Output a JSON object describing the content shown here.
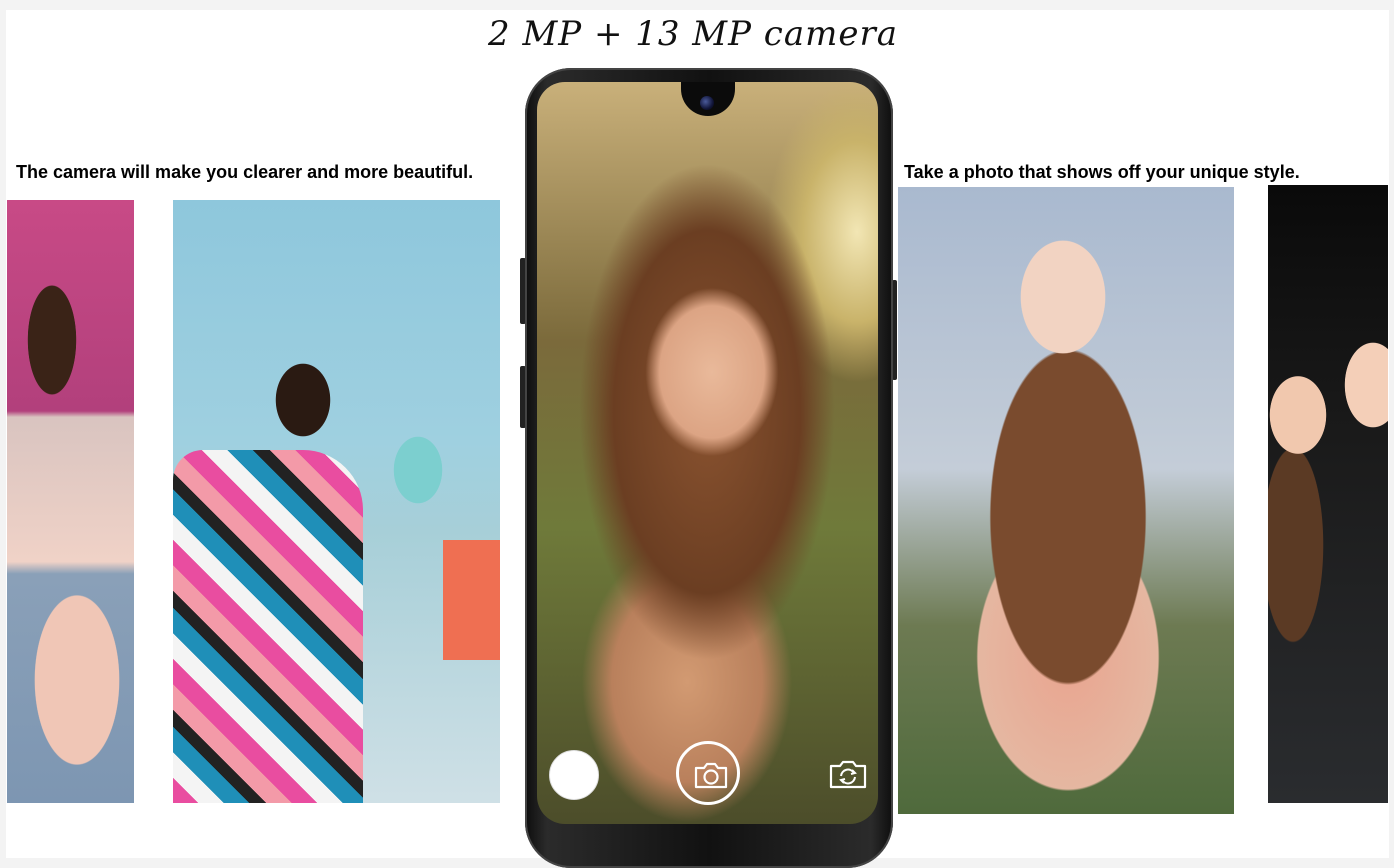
{
  "headline": "2 MP + 13 MP camera",
  "captions": {
    "left": "The camera will make you clearer and more beautiful.",
    "right": "Take a photo that shows off your unique style."
  },
  "camera_controls": {
    "gallery_icon": "circle-thumbnail-icon",
    "shutter_icon": "camera-icon",
    "switch_icon": "camera-switch-icon"
  }
}
